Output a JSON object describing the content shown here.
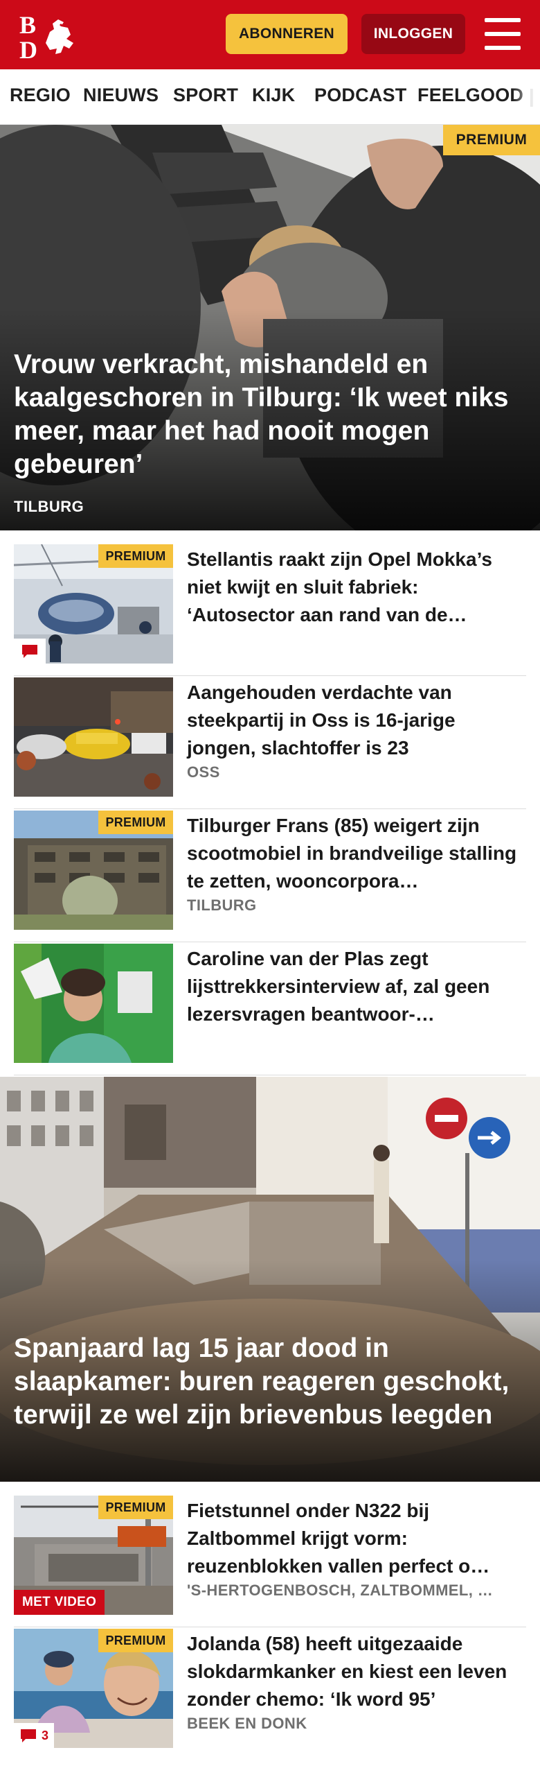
{
  "header": {
    "subscribe_label": "ABONNEREN",
    "login_label": "INLOGGEN",
    "brand_color": "#cc0a18",
    "subscribe_color": "#f5c23d",
    "logo_text": "BD"
  },
  "nav": {
    "items": [
      "REGIO",
      "NIEUWS",
      "SPORT",
      "KIJK",
      "PODCAST",
      "FEELGOOD"
    ]
  },
  "articles": {
    "hero1": {
      "title": "Vrouw verkracht, mishandeld en kaalgeschoren in Tilburg: ‘Ik weet niks meer, maar het had nooit mogen gebeuren’",
      "label": "TILBURG",
      "premium": "PREMIUM"
    },
    "item1": {
      "title": "Stellantis raakt zijn Opel Mokka’s niet kwijt en sluit fabriek: ‘Autosector aan rand van de…",
      "premium": "PREMIUM",
      "comment_icon": "speech-bubble-icon"
    },
    "item2": {
      "title": "Aangehouden verdachte van steekpartij in Oss is 16-jarige jongen, slachtoffer is 23",
      "label": "OSS"
    },
    "item3": {
      "title": "Tilburger Frans (85) weigert zijn scootmobiel in brandveilige stalling te zetten, wooncorpora…",
      "label": "TILBURG",
      "premium": "PREMIUM"
    },
    "item4": {
      "title": "Caroline van der Plas zegt lijsttrekkersinterview af, zal geen lezersvragen beantwoor-…"
    },
    "hero2": {
      "title": "Spanjaard lag 15 jaar dood in slaapkamer: buren reageren geschokt, terwijl ze wel zijn brievenbus leegden"
    },
    "item5": {
      "title": "Fietstunnel onder N322 bij Zaltbommel krijgt vorm: reuzenblokken vallen perfect o…",
      "label": "'S-HERTOGENBOSCH, ZALTBOMMEL, …",
      "premium": "PREMIUM",
      "video": "MET VIDEO"
    },
    "item6": {
      "title": "Jolanda (58) heeft uitgezaaide slokdarmkanker en kiest een leven zonder chemo: ‘Ik word 95’",
      "label": "BEEK EN DONK",
      "premium": "PREMIUM",
      "comments": "3"
    }
  }
}
